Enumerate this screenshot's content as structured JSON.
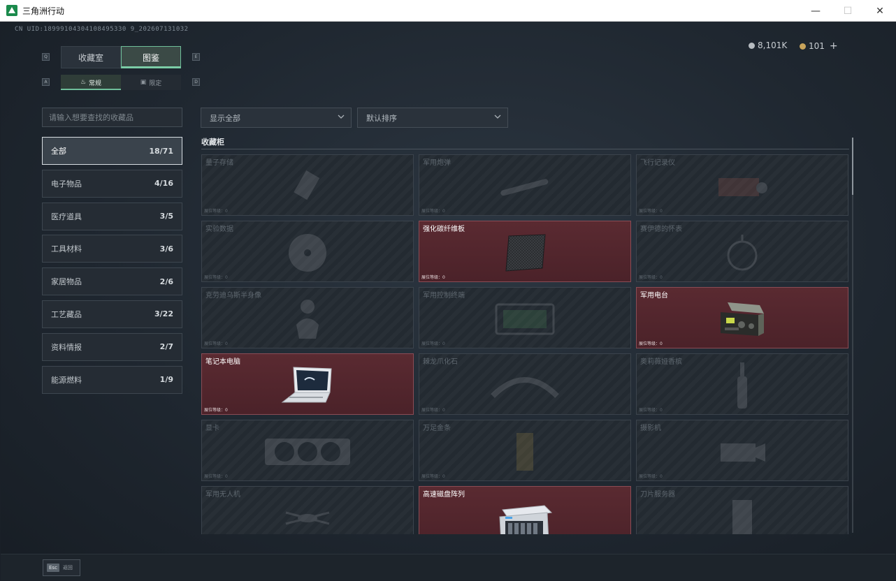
{
  "window": {
    "title": "三角洲行动",
    "minimize": "—",
    "maximize": "☐",
    "close": "✕"
  },
  "uid": "CN UID:18999104304108495330 9_202607131032",
  "currency": {
    "primary": {
      "value": "8,101K",
      "color": "#b7bcc1"
    },
    "secondary": {
      "value": "101",
      "plus": "+",
      "color": "#c7a35a"
    }
  },
  "key_hints": {
    "tab_left": "Q",
    "tab_right": "E",
    "sub_left": "A",
    "sub_right": "D"
  },
  "tabs": [
    {
      "label": "收藏室",
      "active": false
    },
    {
      "label": "图鉴",
      "active": true
    }
  ],
  "subtabs": [
    {
      "label": "常规",
      "icon": "flame-icon",
      "active": true
    },
    {
      "label": "限定",
      "icon": "image-icon",
      "active": false
    }
  ],
  "search": {
    "placeholder": "请输入想要查找的收藏品",
    "value": ""
  },
  "filters": [
    {
      "label": "显示全部"
    },
    {
      "label": "默认排序"
    }
  ],
  "categories": [
    {
      "label": "全部",
      "count": "18/71",
      "active": true
    },
    {
      "label": "电子物品",
      "count": "4/16"
    },
    {
      "label": "医疗道具",
      "count": "3/5"
    },
    {
      "label": "工具材料",
      "count": "3/6"
    },
    {
      "label": "家居物品",
      "count": "2/6"
    },
    {
      "label": "工艺藏品",
      "count": "3/22"
    },
    {
      "label": "资料情报",
      "count": "2/7"
    },
    {
      "label": "能源燃料",
      "count": "1/9"
    }
  ],
  "section_title": "收藏柜",
  "level_label": "展位等级：0",
  "items": [
    {
      "name": "量子存储",
      "owned": false,
      "icon": "memory-card-icon"
    },
    {
      "name": "军用炮弹",
      "owned": false,
      "icon": "shell-icon"
    },
    {
      "name": "飞行记录仪",
      "owned": false,
      "icon": "flight-recorder-icon"
    },
    {
      "name": "实验数据",
      "owned": false,
      "icon": "disc-icon"
    },
    {
      "name": "强化碳纤维板",
      "owned": true,
      "icon": "carbon-plate-icon"
    },
    {
      "name": "赛伊德的怀表",
      "owned": false,
      "icon": "pocket-watch-icon"
    },
    {
      "name": "克劳迪乌斯半身像",
      "owned": false,
      "icon": "bust-icon"
    },
    {
      "name": "军用控制终端",
      "owned": false,
      "icon": "terminal-icon"
    },
    {
      "name": "军用电台",
      "owned": true,
      "icon": "radio-icon"
    },
    {
      "name": "笔记本电脑",
      "owned": true,
      "icon": "laptop-icon"
    },
    {
      "name": "棘龙爪化石",
      "owned": false,
      "icon": "claw-fossil-icon"
    },
    {
      "name": "奥莉薇娅香槟",
      "owned": false,
      "icon": "champagne-icon"
    },
    {
      "name": "显卡",
      "owned": false,
      "icon": "gpu-icon"
    },
    {
      "name": "万足金条",
      "owned": false,
      "icon": "gold-bar-icon"
    },
    {
      "name": "摄影机",
      "owned": false,
      "icon": "camera-icon"
    },
    {
      "name": "军用无人机",
      "owned": false,
      "icon": "drone-icon"
    },
    {
      "name": "高速磁盘阵列",
      "owned": true,
      "icon": "disk-array-icon"
    },
    {
      "name": "刀片服务器",
      "owned": false,
      "icon": "blade-server-icon"
    }
  ],
  "footer": {
    "esc_key": "Esc",
    "back_label": "返回"
  }
}
